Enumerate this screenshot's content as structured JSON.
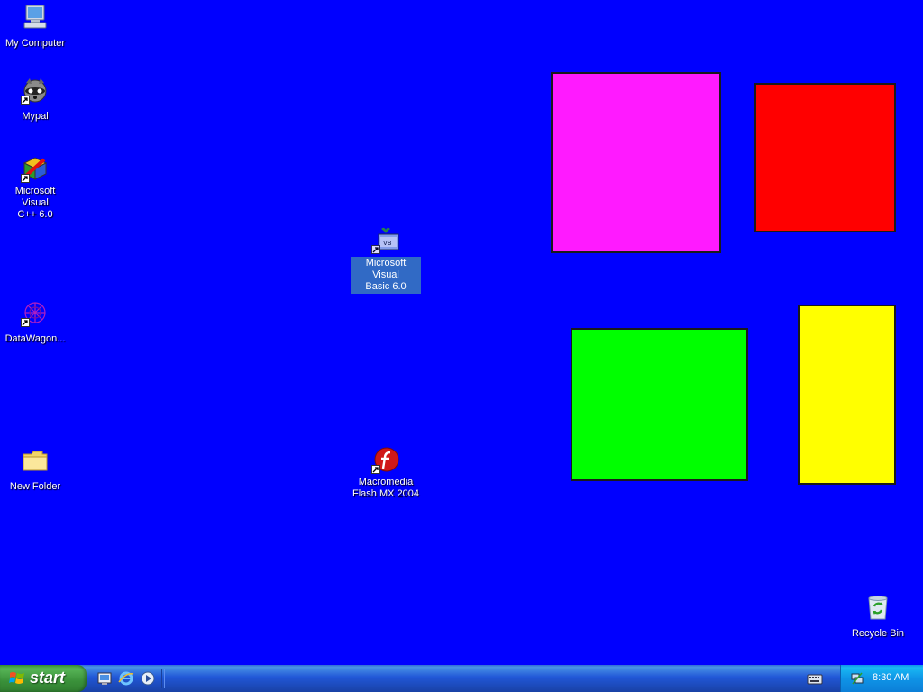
{
  "desktop": {
    "background_color": "#0000ff",
    "icons": {
      "my_computer": {
        "label": "My Computer",
        "icon": "my-computer-icon"
      },
      "mypal": {
        "label": "Mypal",
        "icon": "raccoon-icon"
      },
      "vcpp": {
        "label_line1": "Microsoft Visual",
        "label_line2": "C++ 6.0",
        "icon": "visual-cpp-icon"
      },
      "datawagon": {
        "label": "DataWagon...",
        "icon": "datawagon-icon"
      },
      "new_folder": {
        "label": "New Folder",
        "icon": "folder-icon"
      },
      "vb": {
        "label_line1": "Microsoft Visual",
        "label_line2": "Basic 6.0",
        "icon": "visual-basic-icon",
        "selected": true
      },
      "flash": {
        "label_line1": "Macromedia",
        "label_line2": "Flash MX 2004",
        "icon": "flash-icon"
      },
      "recycle_bin": {
        "label": "Recycle Bin",
        "icon": "recycle-bin-icon"
      }
    },
    "shapes": {
      "magenta": "#ff1aff",
      "red": "#ff0000",
      "green": "#00ff00",
      "yellow": "#ffff00"
    }
  },
  "taskbar": {
    "start_label": "start",
    "quick_launch": [
      "show-desktop-icon",
      "internet-explorer-icon",
      "media-player-icon"
    ],
    "tray": {
      "time": "8:30 AM",
      "icons": [
        "keyboard-icon",
        "network-icon"
      ]
    }
  }
}
